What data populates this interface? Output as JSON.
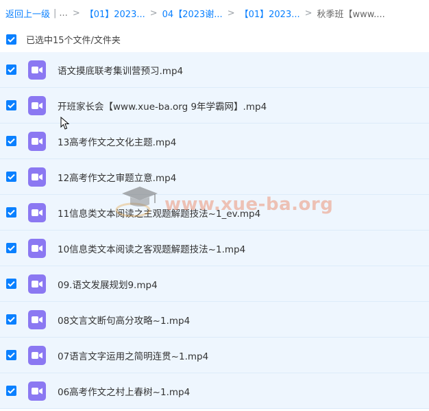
{
  "breadcrumb": {
    "back_label": "返回上一级",
    "ellipsis": "...",
    "crumbs": [
      "【01】2023...",
      "04【2023谢...",
      "【01】2023..."
    ],
    "current": "秋季班【www...."
  },
  "selection": {
    "status_text": "已选中15个文件/文件夹"
  },
  "files": [
    {
      "name": "语文摸底联考集训营预习.mp4",
      "icon": "video-file-icon"
    },
    {
      "name": "开班家长会【www.xue-ba.org 9年学霸网】.mp4",
      "icon": "video-file-icon"
    },
    {
      "name": "13高考作文之文化主题.mp4",
      "icon": "video-file-icon"
    },
    {
      "name": "12高考作文之审题立意.mp4",
      "icon": "video-file-icon"
    },
    {
      "name": "11信息类文本阅读之主观题解题技法~1_ev.mp4",
      "icon": "video-file-icon"
    },
    {
      "name": "10信息类文本阅读之客观题解题技法~1.mp4",
      "icon": "video-file-icon"
    },
    {
      "name": "09.语文发展规划9.mp4",
      "icon": "video-file-icon"
    },
    {
      "name": "08文言文断句高分攻略~1.mp4",
      "icon": "video-file-icon"
    },
    {
      "name": "07语言文字运用之简明连贯~1.mp4",
      "icon": "video-file-icon"
    },
    {
      "name": "06高考作文之村上春树~1.mp4",
      "icon": "video-file-icon"
    }
  ],
  "watermark": {
    "text": "www.xue-ba.org"
  },
  "colors": {
    "accent": "#0a80ff",
    "row_selected_bg": "#eef6fe",
    "video_icon": "#8b78f2"
  }
}
